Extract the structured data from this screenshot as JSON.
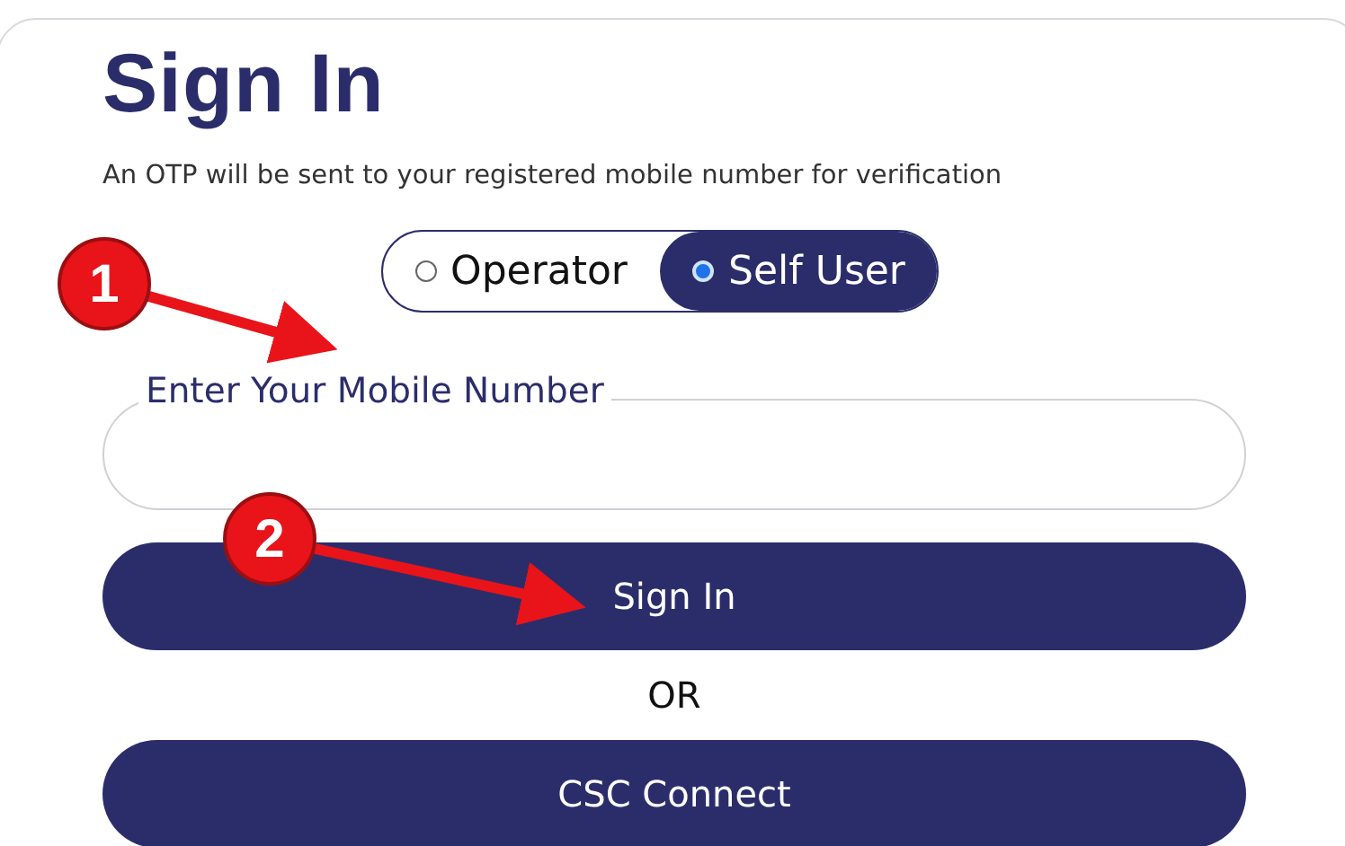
{
  "title": "Sign In",
  "subtitle": "An OTP will be sent to your registered mobile number for verification",
  "user_types": [
    {
      "label": "Operator",
      "selected": false
    },
    {
      "label": "Self User",
      "selected": true
    }
  ],
  "mobile_field": {
    "label": "Enter Your Mobile Number"
  },
  "buttons": [
    {
      "label": "Sign In"
    },
    {
      "label": "CSC Connect"
    }
  ],
  "separator": "OR",
  "callouts": [
    {
      "label": "1"
    },
    {
      "label": "2"
    }
  ]
}
